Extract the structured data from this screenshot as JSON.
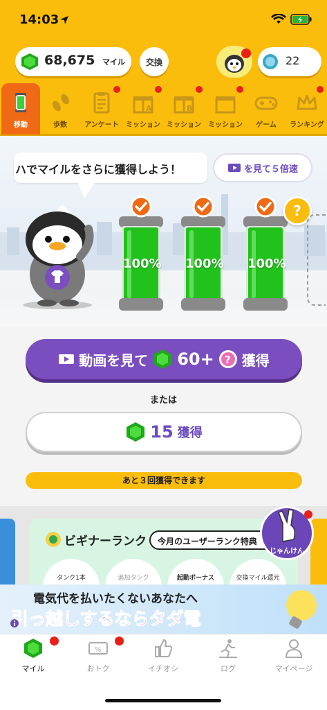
{
  "status": {
    "time": "14:03"
  },
  "header": {
    "miles_value": "68,675",
    "miles_unit": "マイル",
    "exchange_label": "交換",
    "coin_count": "22"
  },
  "nav": {
    "items": [
      {
        "label": "移動",
        "icon": "tank-icon",
        "active": true
      },
      {
        "label": "歩数",
        "icon": "footprints-icon"
      },
      {
        "label": "アンケート",
        "icon": "clipboard-icon"
      },
      {
        "label": "ミッション",
        "icon": "gift-a-icon"
      },
      {
        "label": "ミッション",
        "icon": "gift-b-icon"
      },
      {
        "label": "ミッション",
        "icon": "gift-game-icon"
      },
      {
        "label": "ゲーム",
        "icon": "gamepad-icon"
      },
      {
        "label": "ランキング",
        "icon": "crown-icon"
      }
    ]
  },
  "main": {
    "speech_text": "ハでマイルをさらに獲得しよう！",
    "speed_button": "を見て５倍速",
    "tanks": [
      {
        "percent": "100%",
        "level": 1.0
      },
      {
        "percent": "100%",
        "level": 1.0
      },
      {
        "percent": "100%",
        "level": 1.0
      }
    ],
    "mystery_badge": "?",
    "video_button": {
      "text": "動画を見て",
      "amount": "60+",
      "suffix": "獲得"
    },
    "or_label": "または",
    "get_button": {
      "amount": "15",
      "suffix": "獲得"
    },
    "remaining_text": "あと３回獲得できます"
  },
  "rank": {
    "title": "ビギナーランク",
    "pill": "今月のユーザーランク特典",
    "items": [
      "タンク1本",
      "追加タンク",
      "起動ボーナス",
      "交換マイル還元"
    ]
  },
  "janken_label": "じゃんけん",
  "ad": {
    "line1": "電気代を払いたくないあなたへ",
    "line2": "引っ越しするならタダ電"
  },
  "tabbar": {
    "items": [
      {
        "label": "マイル",
        "icon": "gem-icon",
        "active": true
      },
      {
        "label": "おトク",
        "icon": "coupon-icon"
      },
      {
        "label": "イチオシ",
        "icon": "thumbs-up-icon"
      },
      {
        "label": "ログ",
        "icon": "runner-icon"
      },
      {
        "label": "マイページ",
        "icon": "person-icon"
      }
    ]
  },
  "colors": {
    "brand_yellow": "#fbbd0c",
    "purple": "#7b4ec0",
    "tank_green": "#22c21c",
    "active_orange": "#f06a16",
    "badge_red": "#e8201a"
  }
}
